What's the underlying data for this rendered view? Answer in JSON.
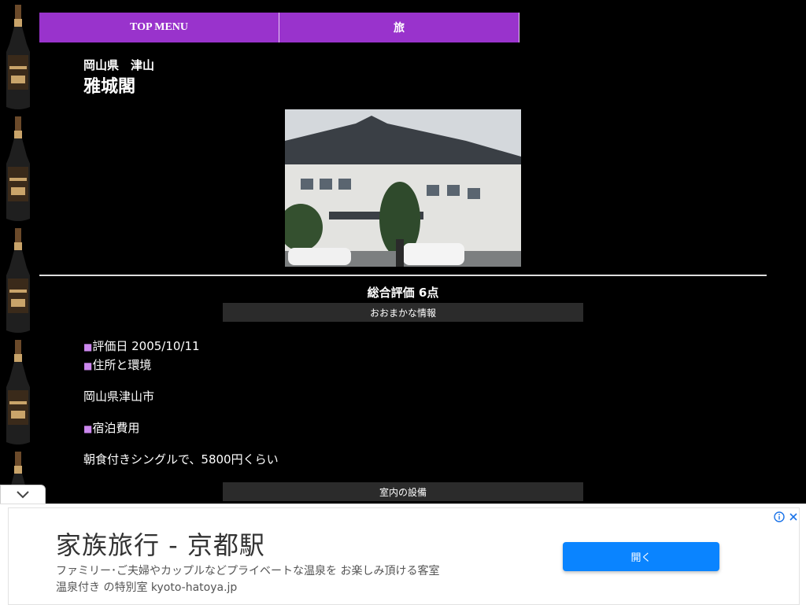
{
  "nav": {
    "items": [
      {
        "label": "TOP MENU"
      },
      {
        "label": "旅"
      }
    ],
    "color": "#9933cc"
  },
  "header": {
    "location": "岡山県　津山",
    "title": "雅城閣"
  },
  "score": {
    "label": "総合評価 6点"
  },
  "sections": {
    "overview": "おおまかな情報",
    "facilities": "室内の設備"
  },
  "details": {
    "date_label": "■",
    "date_text": "評価日 2005/10/11",
    "address_label": "■",
    "address_heading": "住所と環境",
    "address_value": "岡山県津山市",
    "cost_label": "■",
    "cost_heading": "宿泊費用",
    "cost_value": "朝食付きシングルで、5800円くらい"
  },
  "ad": {
    "title": "家族旅行 - 京都駅",
    "desc_line1": "ファミリー･ご夫婦やカップルなどプライベートな温泉を お楽しみ頂ける客室",
    "desc_line2": "温泉付き の特別室 kyoto-hatoya.jp",
    "button": "開く",
    "button_color": "#0a84ff"
  }
}
